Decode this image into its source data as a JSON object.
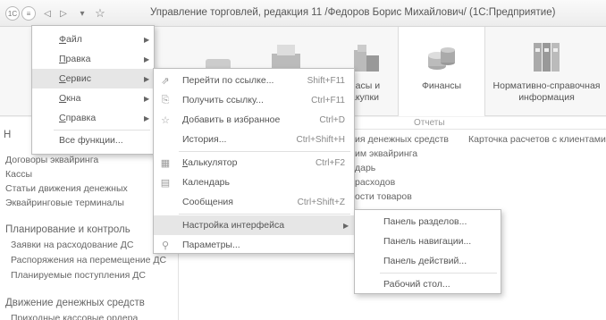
{
  "window": {
    "title": "Управление торговлей, редакция 11 /Федоров Борис Михайлович/  (1С:Предприятие)",
    "logo": "1С",
    "menu_button": "≡",
    "back": "◁",
    "forward": "▷",
    "dropdown": "▾",
    "star": "☆"
  },
  "sections": [
    {
      "label": "Запасы и\nзакупки",
      "shown": "пасы и\nакупки"
    },
    {
      "label": "Финансы"
    },
    {
      "label": "Нормативно-справочная\nинформация"
    }
  ],
  "nav": {
    "group_header": "Н",
    "items": [
      "Договоры эквайринга",
      "Кассы",
      "Статьи движения денежных",
      "Эквайринговые терминалы"
    ],
    "planning": {
      "header": "Планирование и контроль",
      "items": [
        "Заявки на расходование ДС",
        "Распоряжения на перемещение ДС",
        "Планируемые поступления ДС"
      ]
    },
    "movement": {
      "header": "Движение денежных средств",
      "items": [
        "Приходные кассовые ордера"
      ]
    }
  },
  "content": {
    "reports_title": "Отчеты",
    "left_col": [
      "ия денежных средств",
      "им эквайринга",
      "дарь",
      "расходов",
      "ости товаров"
    ],
    "right_col": [
      "Карточка расчетов с клиентами"
    ]
  },
  "main_menu": [
    {
      "label": "Файл",
      "accel": "Ф",
      "rest": "айл",
      "submenu": true
    },
    {
      "label": "Правка",
      "accel": "П",
      "rest": "равка",
      "submenu": true
    },
    {
      "label": "Сервис",
      "accel": "С",
      "rest": "ервис",
      "submenu": true,
      "highlighted": true
    },
    {
      "label": "Окна",
      "accel": "О",
      "rest": "кна",
      "submenu": true
    },
    {
      "label": "Справка",
      "accel": "С",
      "rest": "правка",
      "submenu": true
    },
    {
      "label": "Все функции..."
    }
  ],
  "service_menu": [
    {
      "label": "Перейти по ссылке...",
      "shortcut": "Shift+F11",
      "icon": "go-link-icon"
    },
    {
      "label": "Получить ссылку...",
      "shortcut": "Ctrl+F11",
      "icon": "get-link-icon"
    },
    {
      "label": "Добавить в избранное",
      "shortcut": "Ctrl+D",
      "icon": "favorite-star-icon"
    },
    {
      "label": "История...",
      "shortcut": "Ctrl+Shift+H"
    },
    {
      "label": "Калькулятор",
      "accel": "К",
      "rest": "алькулятор",
      "shortcut": "Ctrl+F2",
      "icon": "calculator-icon"
    },
    {
      "label": "Календарь",
      "icon": "calendar-icon"
    },
    {
      "label": "Сообщения",
      "shortcut": "Ctrl+Shift+Z"
    },
    {
      "label": "Настройка интерфейса",
      "submenu": true,
      "highlighted": true
    },
    {
      "label": "Параметры...",
      "icon": "settings-icon"
    }
  ],
  "interface_menu": [
    {
      "label": "Панель разделов..."
    },
    {
      "label": "Панель навигации..."
    },
    {
      "label": "Панель действий..."
    },
    {
      "label": "Рабочий стол..."
    }
  ]
}
